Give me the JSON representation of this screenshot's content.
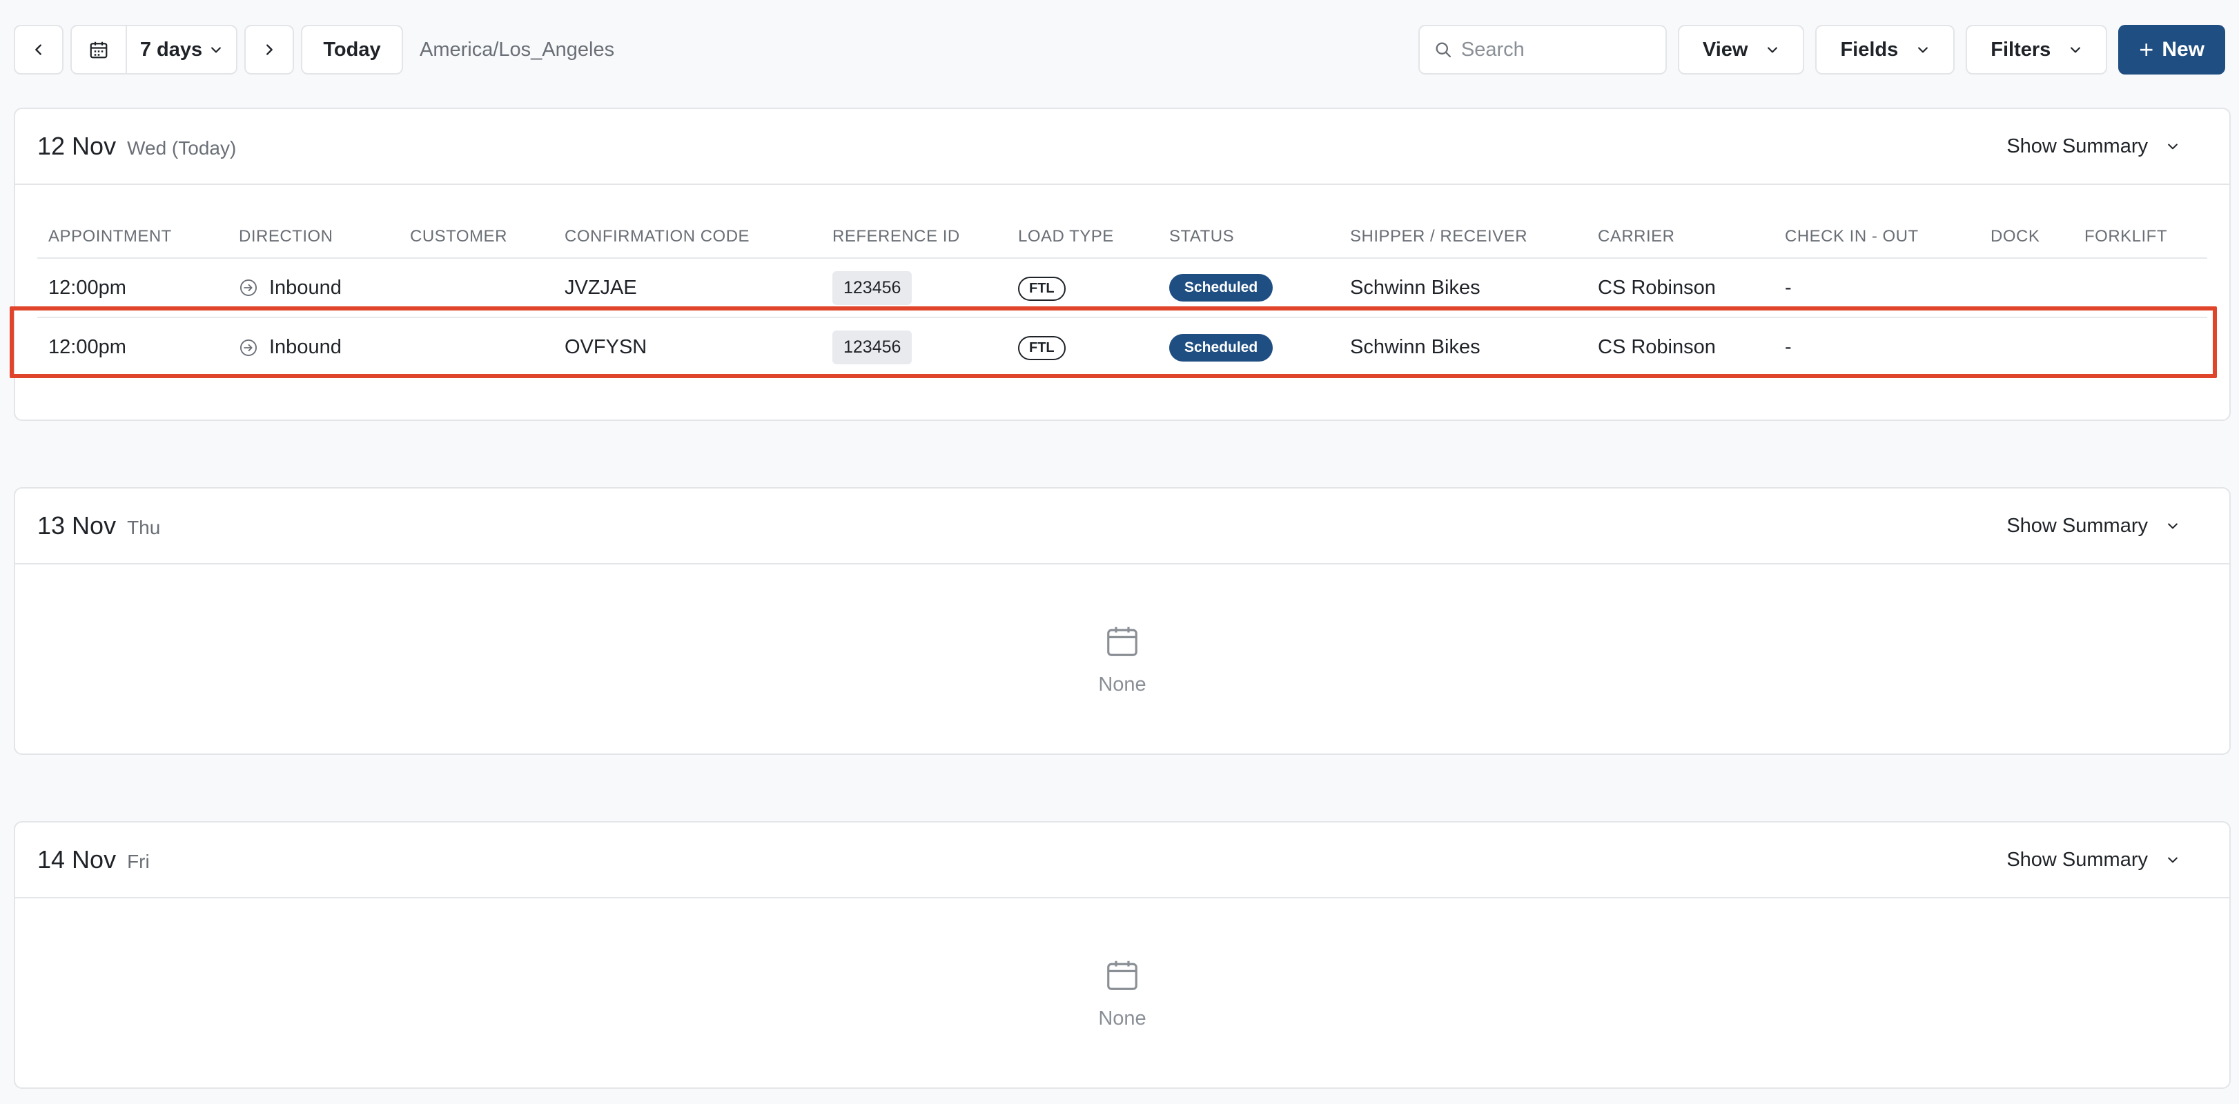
{
  "toolbar": {
    "range_label": "7 days",
    "today_label": "Today",
    "timezone": "America/Los_Angeles",
    "search_placeholder": "Search",
    "view_label": "View",
    "fields_label": "Fields",
    "filters_label": "Filters",
    "new_label": "New"
  },
  "columns": [
    "APPOINTMENT",
    "DIRECTION",
    "CUSTOMER",
    "CONFIRMATION CODE",
    "REFERENCE ID",
    "LOAD TYPE",
    "STATUS",
    "SHIPPER / RECEIVER",
    "CARRIER",
    "CHECK IN - OUT",
    "DOCK",
    "FORKLIFT"
  ],
  "days": [
    {
      "date": "12 Nov",
      "sub": "Wed (Today)",
      "summary_label": "Show Summary",
      "rows": [
        {
          "appointment": "12:00pm",
          "direction": "Inbound",
          "customer": "",
          "confirmation": "JVZJAE",
          "reference": "123456",
          "load_type": "FTL",
          "status": "Scheduled",
          "shipper": "Schwinn Bikes",
          "carrier": "CS Robinson",
          "check": "-",
          "dock": "",
          "forklift": ""
        },
        {
          "appointment": "12:00pm",
          "direction": "Inbound",
          "customer": "",
          "confirmation": "OVFYSN",
          "reference": "123456",
          "load_type": "FTL",
          "status": "Scheduled",
          "shipper": "Schwinn Bikes",
          "carrier": "CS Robinson",
          "check": "-",
          "dock": "",
          "forklift": ""
        }
      ]
    },
    {
      "date": "13 Nov",
      "sub": "Thu",
      "summary_label": "Show Summary",
      "empty_label": "None"
    },
    {
      "date": "14 Nov",
      "sub": "Fri",
      "summary_label": "Show Summary",
      "empty_label": "None"
    }
  ],
  "colors": {
    "accent": "#1f4e82",
    "highlight": "#e0442a"
  },
  "icons": [
    "chevron-left-icon",
    "calendar-icon",
    "chevron-down-icon",
    "chevron-right-icon",
    "search-icon",
    "plus-icon",
    "inbound-arrow-icon"
  ]
}
